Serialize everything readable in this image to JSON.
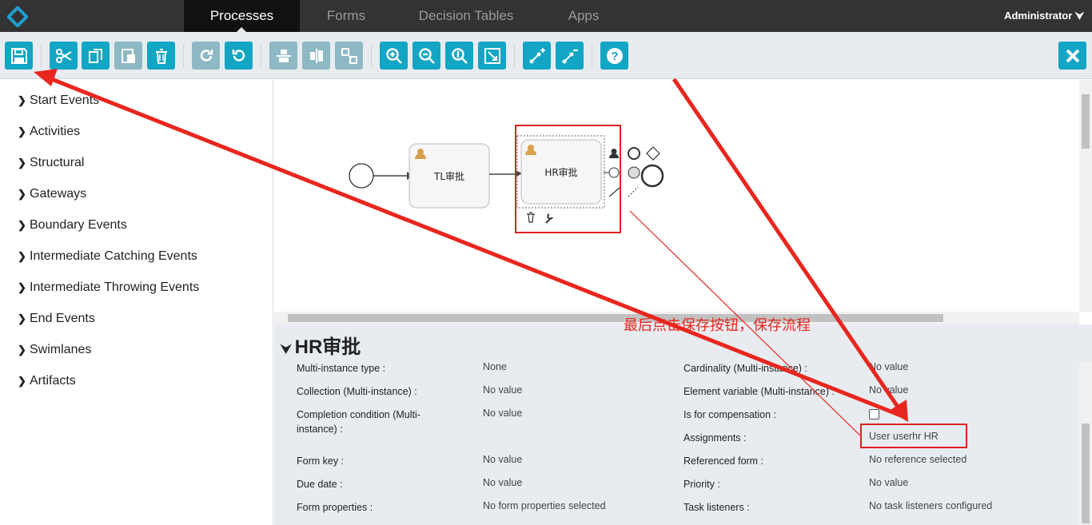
{
  "nav": {
    "tabs": [
      {
        "label": "Processes"
      },
      {
        "label": "Forms"
      },
      {
        "label": "Decision Tables"
      },
      {
        "label": "Apps"
      }
    ],
    "user": "Administrator"
  },
  "toolbar": {
    "buttons": [
      "save-icon",
      "cut-icon",
      "copy-icon",
      "paste-icon",
      "delete-icon",
      "redo-icon",
      "undo-icon",
      "align-horizontal-icon",
      "align-vertical-icon",
      "same-size-icon",
      "zoom-in-icon",
      "zoom-out-icon",
      "zoom-actual-icon",
      "zoom-fit-icon",
      "bend-point-add-icon",
      "bend-point-remove-icon",
      "help-icon",
      "close-icon"
    ]
  },
  "palette": {
    "items": [
      {
        "label": "Start Events"
      },
      {
        "label": "Activities"
      },
      {
        "label": "Structural"
      },
      {
        "label": "Gateways"
      },
      {
        "label": "Boundary Events"
      },
      {
        "label": "Intermediate Catching Events"
      },
      {
        "label": "Intermediate Throwing Events"
      },
      {
        "label": "End Events"
      },
      {
        "label": "Swimlanes"
      },
      {
        "label": "Artifacts"
      }
    ]
  },
  "diagram": {
    "task1": "TL审批",
    "task2": "HR审批"
  },
  "annotation": "最后点击保存按钮，保存流程",
  "properties": {
    "title": "HR审批",
    "rows": [
      {
        "l1": "Multi-instance type :",
        "v1": "None",
        "l2": "Cardinality (Multi-instance) :",
        "v2": "No value"
      },
      {
        "l1": "Collection (Multi-instance) :",
        "v1": "No value",
        "l2": "Element variable (Multi-instance) :",
        "v2": "No value"
      },
      {
        "l1": "Completion condition (Multi-instance) :",
        "v1": "No value",
        "l2": "Is for compensation :",
        "v2": ""
      },
      {
        "l1": "",
        "v1": "",
        "l2": "Assignments :",
        "v2": "User userhr HR"
      },
      {
        "l1": "Form key :",
        "v1": "No value",
        "l2": "Referenced form :",
        "v2": "No reference selected"
      },
      {
        "l1": "Due date :",
        "v1": "No value",
        "l2": "Priority :",
        "v2": "No value"
      },
      {
        "l1": "Form properties :",
        "v1": "No form properties selected",
        "l2": "Task listeners :",
        "v2": "No task listeners configured"
      }
    ]
  },
  "colors": {
    "accent": "#12a5c4",
    "annotation": "#e02020",
    "nav_bg": "#333333"
  }
}
